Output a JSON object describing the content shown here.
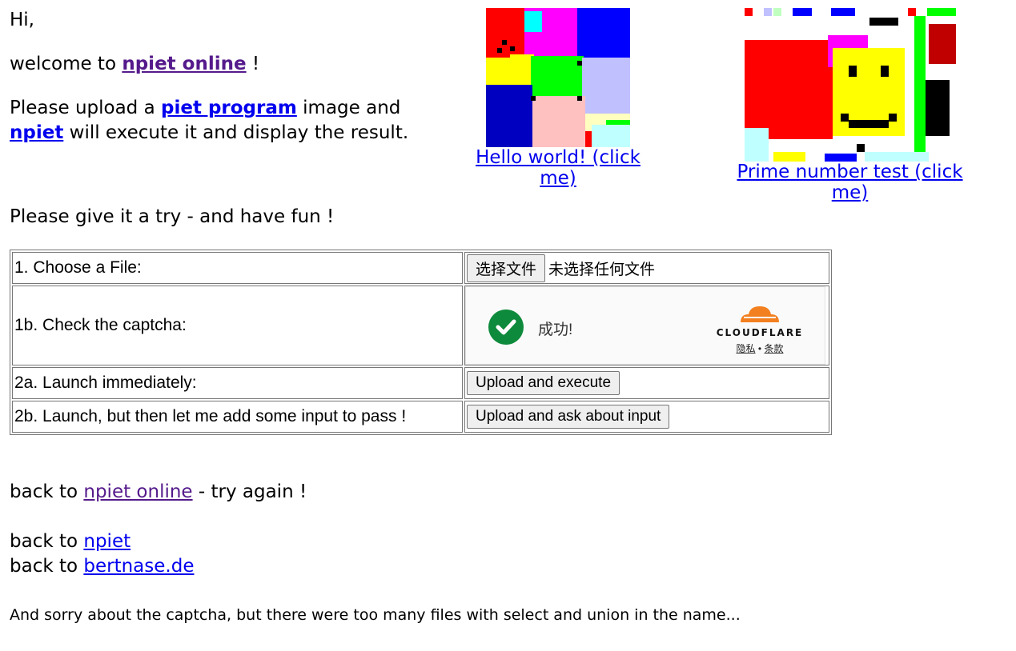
{
  "intro": {
    "greeting": "Hi,",
    "welcome_prefix": "welcome to ",
    "welcome_link": "npiet online",
    "welcome_suffix": " !",
    "upload_prefix": "Please upload a ",
    "upload_link": "piet program",
    "upload_mid": " image and",
    "npiet_link": "npiet",
    "upload_suffix": " will execute it and display the result."
  },
  "demos": [
    {
      "caption": "Hello world! (click me)"
    },
    {
      "caption": "Prime number test (click me)"
    }
  ],
  "try_line": "Please give it a try - and have fun !",
  "form": {
    "rows": [
      {
        "label": "1. Choose a File:",
        "button": "选择文件",
        "status": "未选择任何文件"
      },
      {
        "label": "1b. Check the captcha:"
      },
      {
        "label": "2a. Launch immediately:",
        "button": "Upload and execute"
      },
      {
        "label": "2b. Launch, but then let me add some input to pass !",
        "button": "Upload and ask about input"
      }
    ],
    "captcha": {
      "status": "成功!",
      "brand": "CLOUDFLARE",
      "privacy": "隐私",
      "separator": " • ",
      "terms": "条款",
      "brand_color": "#f38020",
      "check_color": "#0d8a3b"
    }
  },
  "footer": {
    "back_prefix": "back to ",
    "line1_link": "npiet online",
    "line1_suffix": " - try again !",
    "line2_link": "npiet",
    "line3_link": "bertnase.de",
    "sorry": "And sorry about the captcha, but there were too many files with select and union in the name..."
  },
  "icons": [
    "check-icon",
    "cloudflare-logo-icon"
  ]
}
